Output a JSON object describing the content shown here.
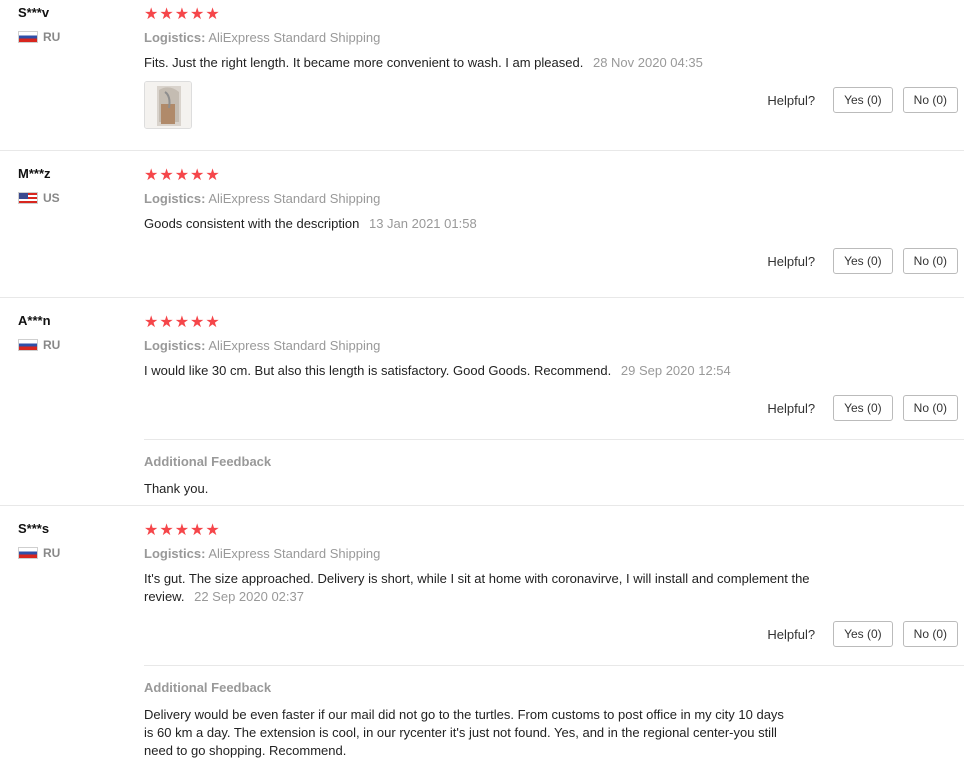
{
  "common": {
    "logistics_label": "Logistics:",
    "helpful_label": "Helpful?",
    "yes_label": "Yes (0)",
    "no_label": "No (0)",
    "additional_title": "Additional Feedback",
    "star_color": "#f5464a",
    "stars_count": 5
  },
  "reviews": [
    {
      "user": "S***v",
      "country": "RU",
      "shipping": "AliExpress Standard Shipping",
      "content": "Fits. Just the right length. It became more convenient to wash. I am pleased.",
      "date": "28 Nov 2020 04:35",
      "has_photo": true
    },
    {
      "user": "M***z",
      "country": "US",
      "shipping": "AliExpress Standard Shipping",
      "content": "Goods consistent with the description",
      "date": "13 Jan 2021 01:58"
    },
    {
      "user": "A***n",
      "country": "RU",
      "shipping": "AliExpress Standard Shipping",
      "content": "I would like 30 cm. But also this length is satisfactory. Good Goods. Recommend.",
      "date": "29 Sep 2020 12:54",
      "additional_feedback": "Thank you."
    },
    {
      "user": "S***s",
      "country": "RU",
      "shipping": "AliExpress Standard Shipping",
      "content_line1": "It's gut. The size approached. Delivery is short, while I sit at home with coronavirve, I will install and complement the",
      "content_line2": "review.",
      "date": "22 Sep 2020 02:37",
      "additional_line1": "Delivery would be even faster if our mail did not go to the turtles. From customs to post office in my city 10 days",
      "additional_line2": "is 60 km a day. The extension is cool, in our rycenter it's just not found. Yes, and in the regional center-you still",
      "additional_line3": "need to go shopping. Recommend."
    }
  ]
}
